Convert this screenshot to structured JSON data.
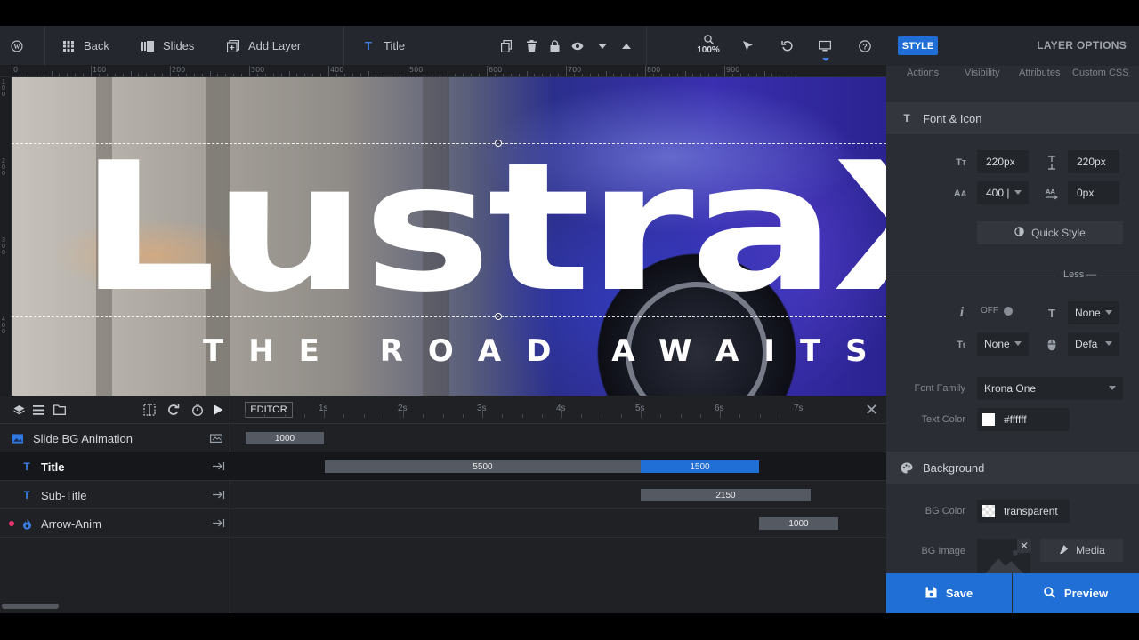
{
  "toolbar": {
    "back_label": "Back",
    "slides_label": "Slides",
    "add_layer_label": "Add Layer",
    "layer_name": "Title",
    "zoom": "100%"
  },
  "ruler": {
    "marks": [
      "0",
      "100",
      "200",
      "300",
      "400",
      "500",
      "600",
      "700",
      "800",
      "900"
    ],
    "vmarks": [
      "100",
      "200",
      "300",
      "400"
    ]
  },
  "canvas": {
    "title": "LustraX",
    "subtitle": "THE ROAD AWAITS"
  },
  "timeline": {
    "editor_label": "EDITOR",
    "seconds": [
      "1s",
      "2s",
      "3s",
      "4s",
      "5s",
      "6s",
      "7s"
    ],
    "rows": [
      {
        "name": "Slide BG Animation",
        "icon": "image-icon",
        "bars": [
          {
            "label": "1000"
          }
        ]
      },
      {
        "name": "Title",
        "icon": "text-icon",
        "bars": [
          {
            "label": "5500"
          },
          {
            "label": "1500"
          }
        ]
      },
      {
        "name": "Sub-Title",
        "icon": "text-icon",
        "bars": [
          {
            "label": "2150"
          }
        ]
      },
      {
        "name": "Arrow-Anim",
        "icon": "fire-icon",
        "bars": [
          {
            "label": "1000"
          }
        ]
      }
    ]
  },
  "panel": {
    "style_label": "STYLE",
    "layer_options_label": "LAYER OPTIONS",
    "subtabs": [
      "Actions",
      "Visibility",
      "Attributes",
      "Custom CSS"
    ],
    "font_icon_title": "Font & Icon",
    "font_size": "220px",
    "line_height": "220px",
    "font_weight": "400 |",
    "letter_spacing": "0px",
    "quick_style": "Quick Style",
    "less_label": "Less",
    "off_label": "OFF",
    "text_transform": "None",
    "text_decoration": "None",
    "cursor": "Defa",
    "font_family_label": "Font Family",
    "font_family_value": "Krona One",
    "text_color_label": "Text Color",
    "text_color_value": "#ffffff",
    "background_title": "Background",
    "bg_color_label": "BG Color",
    "bg_color_value": "transparent",
    "bg_image_label": "BG Image",
    "media_label": "Media",
    "save_label": "Save",
    "preview_label": "Preview"
  },
  "colors": {
    "accent": "#1f6fd6",
    "panel_bg": "#2a2d33",
    "toolbar_bg": "#24272d",
    "timeline_bg": "#1f2125"
  }
}
